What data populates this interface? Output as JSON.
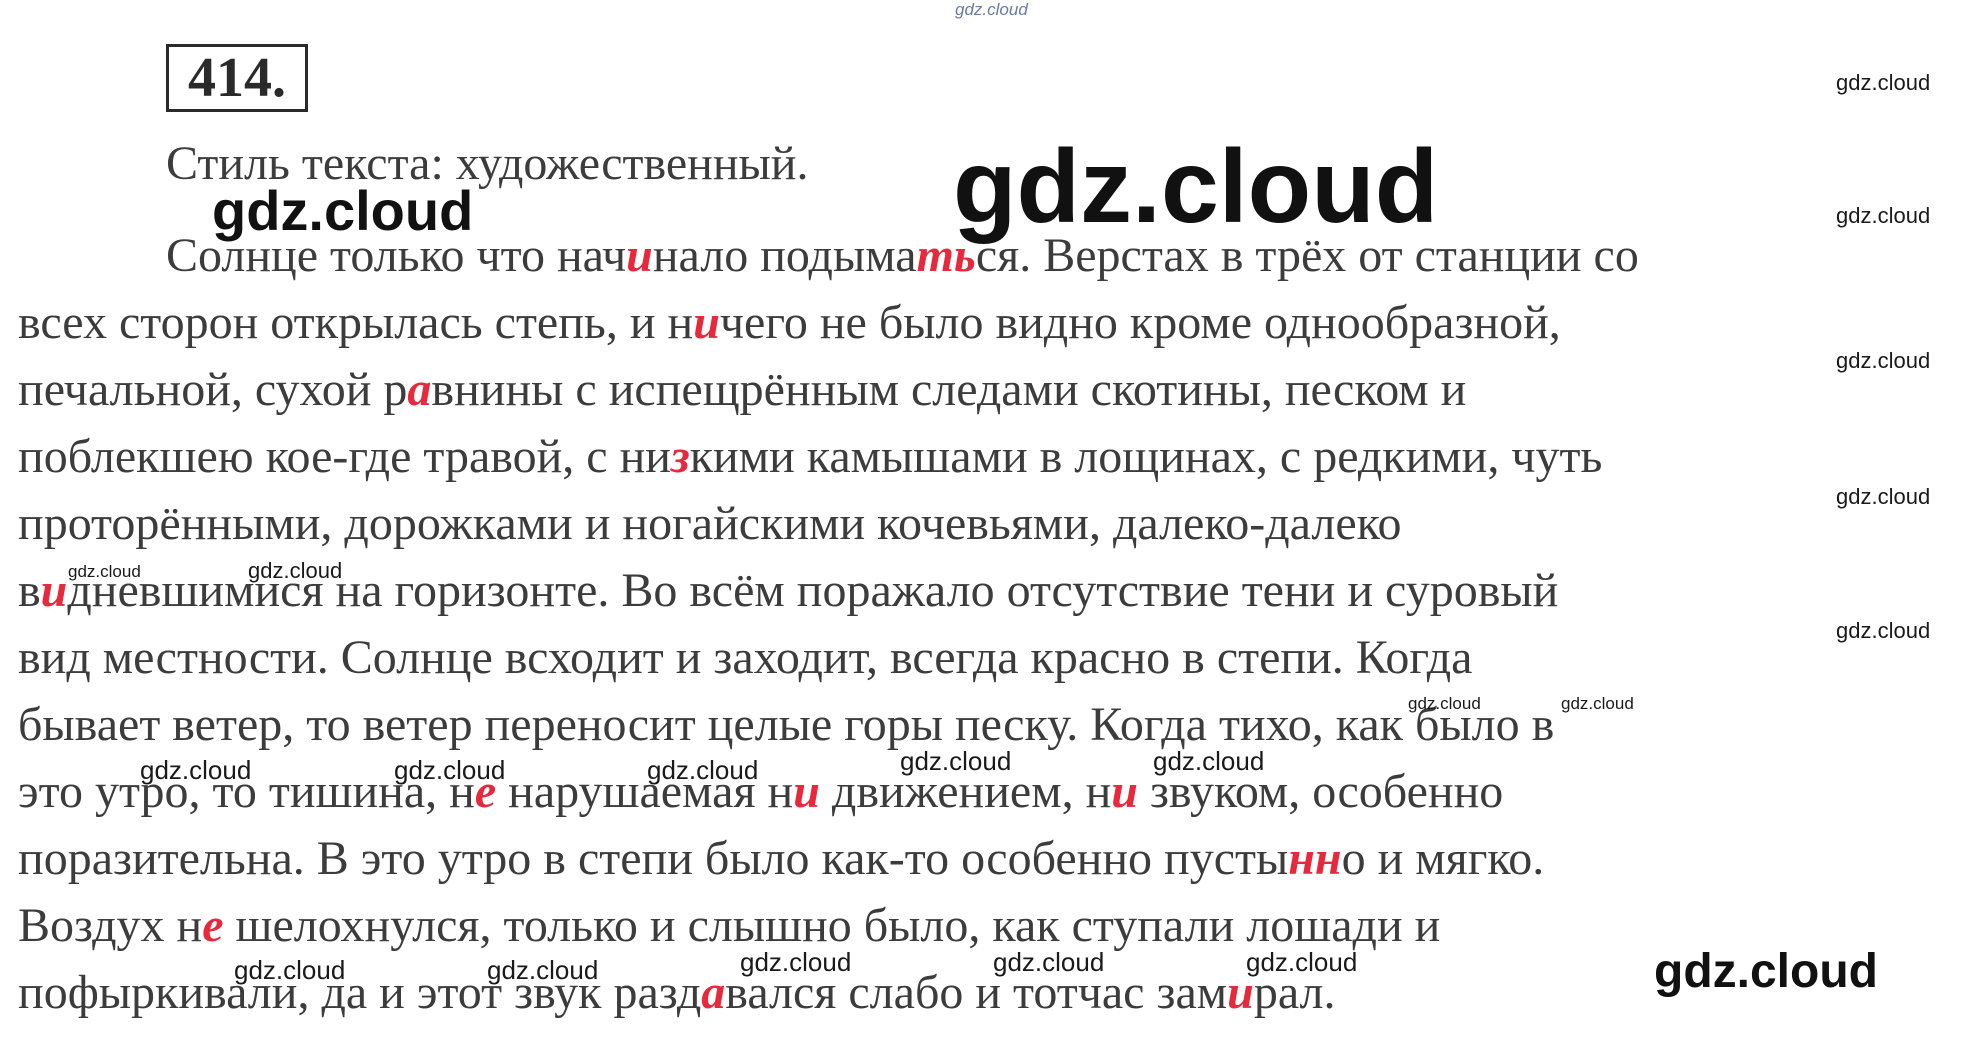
{
  "exercise": {
    "number": "414."
  },
  "style_line": "Стиль текста: художественный.",
  "lines": [
    [
      {
        "t": "Солнце только что нач"
      },
      {
        "t": "и",
        "r": true
      },
      {
        "t": "нало подыма"
      },
      {
        "t": "ть",
        "r": true
      },
      {
        "t": "ся. Верстах в трёх от станции со"
      }
    ],
    [
      {
        "t": "всех сторон открылась степь, и н"
      },
      {
        "t": "и",
        "r": true
      },
      {
        "t": "чего не было видно кроме однообразной,"
      }
    ],
    [
      {
        "t": "печальной, сухой р"
      },
      {
        "t": "а",
        "r": true
      },
      {
        "t": "внины с испещрённым следами скотины, песком и"
      }
    ],
    [
      {
        "t": "поблекшею кое-где травой, с ни"
      },
      {
        "t": "з",
        "r": true
      },
      {
        "t": "кими камышами в лощинах, с редкими, чуть"
      }
    ],
    [
      {
        "t": "проторёнными, дорожками и ногайскими кочевьями, далеко-далеко"
      }
    ],
    [
      {
        "t": "в"
      },
      {
        "t": "и",
        "r": true
      },
      {
        "t": "дневшимися на горизонте. Во всём поражало отсутствие тени и суровый"
      }
    ],
    [
      {
        "t": "вид местности. Солнце всходит и заходит, всегда красно в степи. Когда"
      }
    ],
    [
      {
        "t": "бывает ветер, то ветер переносит целые горы песку. Когда тихо, как было в"
      }
    ],
    [
      {
        "t": "это утро, то тишина, н"
      },
      {
        "t": "е",
        "r": true
      },
      {
        "t": " нарушаемая н"
      },
      {
        "t": "и",
        "r": true
      },
      {
        "t": " движением, н"
      },
      {
        "t": "и",
        "r": true
      },
      {
        "t": " звуком, особенно"
      }
    ],
    [
      {
        "t": "поразительна. В это утро в степи было как-то особенно пусты"
      },
      {
        "t": "нн",
        "r": true
      },
      {
        "t": "о и мягко."
      }
    ],
    [
      {
        "t": "Воздух н"
      },
      {
        "t": "е",
        "r": true
      },
      {
        "t": " шелохнулся, только и слышно было, как ступали лошади и"
      }
    ],
    [
      {
        "t": "пофыркивали, да и этот звук разд"
      },
      {
        "t": "а",
        "r": true
      },
      {
        "t": "вался слабо и тотчас зам"
      },
      {
        "t": "и",
        "r": true
      },
      {
        "t": "рал."
      }
    ]
  ],
  "watermarks": [
    "gdz.cloud",
    "gdz.cloud",
    "gdz.cloud",
    "gdz.cloud",
    "gdz.cloud",
    "gdz.cloud",
    "gdz.cloud",
    "gdz.cloud",
    "gdz.cloud",
    "gdz.cloud",
    "gdz.cloud",
    "gdz.cloud",
    "gdz.cloud",
    "gdz.cloud",
    "gdz.cloud",
    "gdz.cloud",
    "gdz.cloud",
    "gdz.cloud",
    "gdz.cloud",
    "gdz.cloud",
    "gdz.cloud",
    "gdz.cloud",
    "gdz.cloud",
    "gdz.cloud",
    "gdz.cloud",
    "gdz.cloud"
  ]
}
